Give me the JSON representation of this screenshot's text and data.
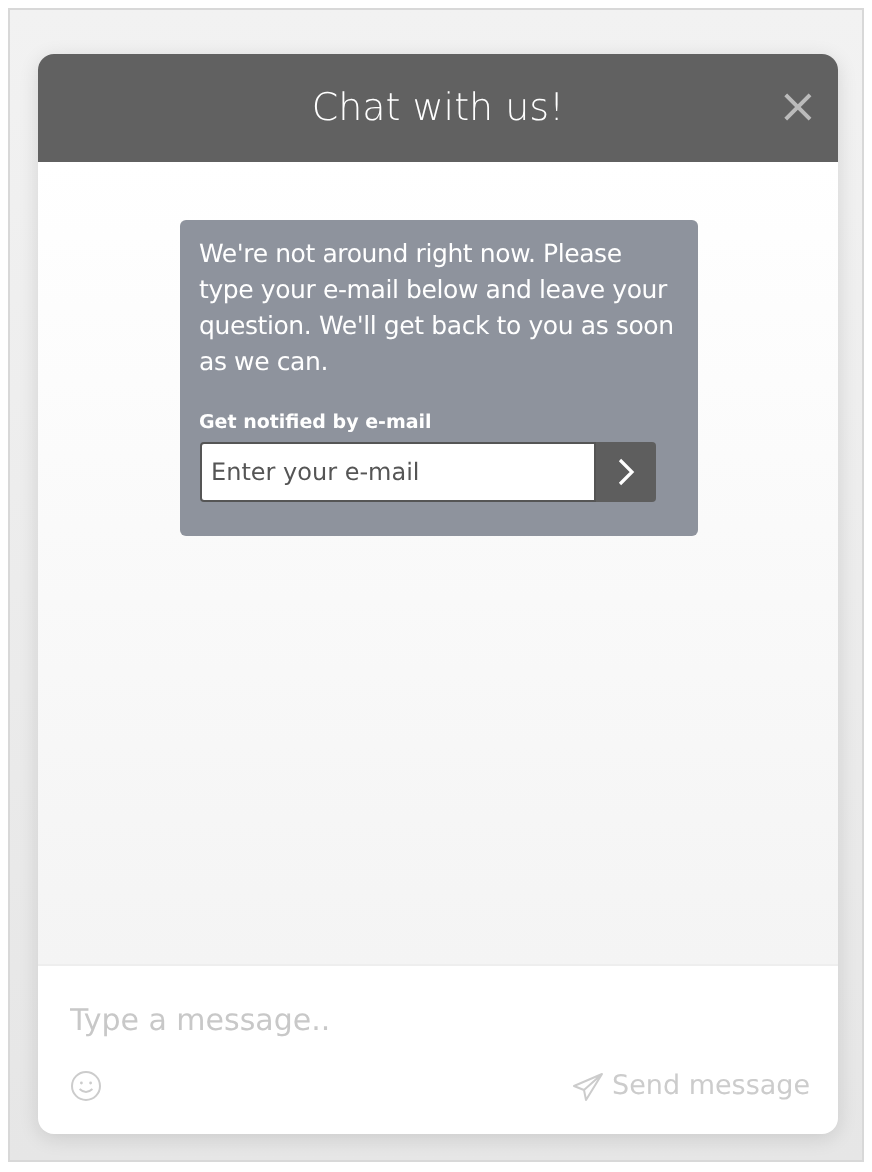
{
  "header": {
    "title": "Chat with us!",
    "close": "×"
  },
  "notice": {
    "message": "We're not around right now. Please type your e-mail below and leave your question. We'll get back to you as soon as we can.",
    "label": "Get notified by e-mail",
    "email": {
      "placeholder": "Enter your e-mail"
    }
  },
  "composer": {
    "placeholder": "Type a message..",
    "send": "Send message"
  }
}
